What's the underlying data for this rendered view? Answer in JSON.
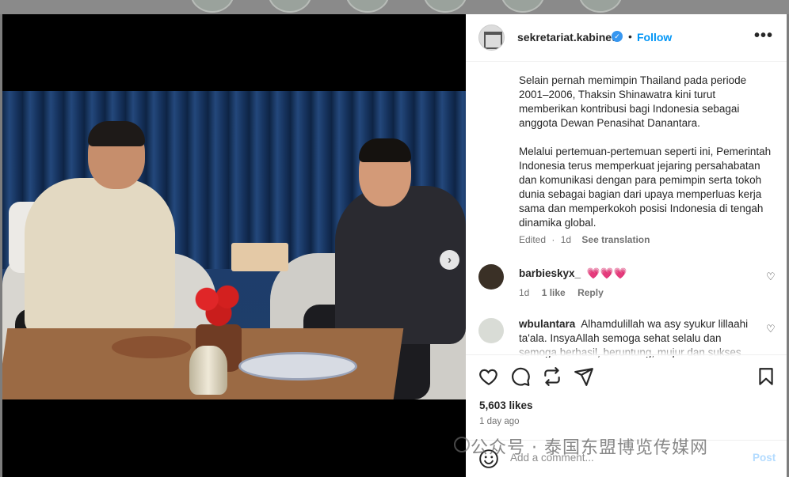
{
  "post": {
    "username": "sekretariat.kabinet",
    "follow_label": "Follow",
    "separator": "•",
    "more_label": "•••",
    "caption_paragraphs": [
      "Selain pernah memimpin Thailand pada periode 2001–2006, Thaksin Shinawatra kini turut memberikan kontribusi bagi Indonesia sebagai anggota Dewan Penasihat Danantara.",
      "Melalui pertemuan-pertemuan seperti ini, Pemerintah Indonesia terus memperkuat jejaring persahabatan dan komunikasi dengan para pemimpin serta tokoh dunia sebagai bagian dari upaya memperluas kerja sama dan memperkokoh posisi Indonesia di tengah dinamika global."
    ],
    "edited_label": "Edited",
    "edited_time": "1d",
    "meta_dot": "·",
    "see_translation": "See translation"
  },
  "comments": [
    {
      "username": "barbieskyx_",
      "text": "💗💗💗",
      "time": "1d",
      "likes": "1 like",
      "reply": "Reply"
    },
    {
      "username": "wbulantara",
      "text": "Alhamdulillah wa asy syukur lillaahi ta'ala. InsyaAllah semoga sehat selalu dan semoga berhasil, beruntung, mujur dan sukses",
      "time": "",
      "likes": "",
      "reply": ""
    }
  ],
  "stats": {
    "likes": "5,603 likes",
    "time_ago": "1 day ago"
  },
  "composer": {
    "placeholder": "Add a comment...",
    "post_label": "Post"
  },
  "watermark": "公众号 · 泰国东盟博览传媒网",
  "colors": {
    "accent": "#0095f6",
    "verified": "#3797f0",
    "post_disabled": "#b3dbff",
    "heart_emoji": "#e0245e"
  },
  "icons": [
    "verified-badge-icon",
    "more-options-icon",
    "next-arrow-icon",
    "heart-icon",
    "comment-icon",
    "share-icon",
    "send-icon",
    "bookmark-icon",
    "emoji-icon"
  ]
}
